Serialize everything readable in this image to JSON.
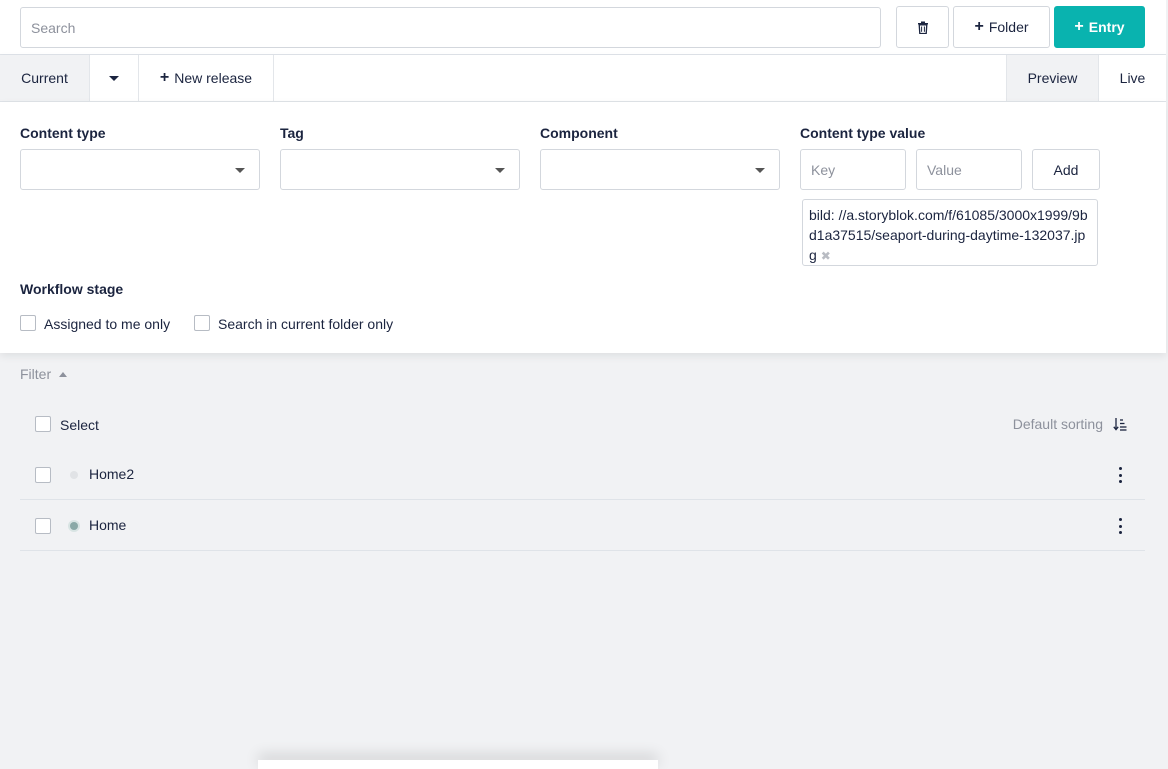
{
  "topbar": {
    "search_placeholder": "Search",
    "folder_label": "Folder",
    "entry_label": "Entry"
  },
  "release_bar": {
    "current_label": "Current",
    "new_release_label": "New release",
    "preview_label": "Preview",
    "live_label": "Live"
  },
  "filters": {
    "content_type_label": "Content type",
    "tag_label": "Tag",
    "component_label": "Component",
    "content_type_value_label": "Content type value",
    "key_placeholder": "Key",
    "value_placeholder": "Value",
    "add_label": "Add",
    "active_tag": "bild: //a.storyblok.com/f/61085/3000x1999/9bd1a37515/seaport-during-daytime-132037.jpg",
    "workflow_stage_label": "Workflow stage",
    "assigned_to_me_label": "Assigned to me only",
    "search_current_folder_label": "Search in current folder only"
  },
  "filter_toggle_label": "Filter",
  "list": {
    "select_label": "Select",
    "sorting_label": "Default sorting",
    "rows": [
      {
        "name": "Home2",
        "status": "draft"
      },
      {
        "name": "Home",
        "status": "published"
      }
    ]
  },
  "colors": {
    "accent": "#09b3af",
    "background": "#f1f2f4"
  }
}
